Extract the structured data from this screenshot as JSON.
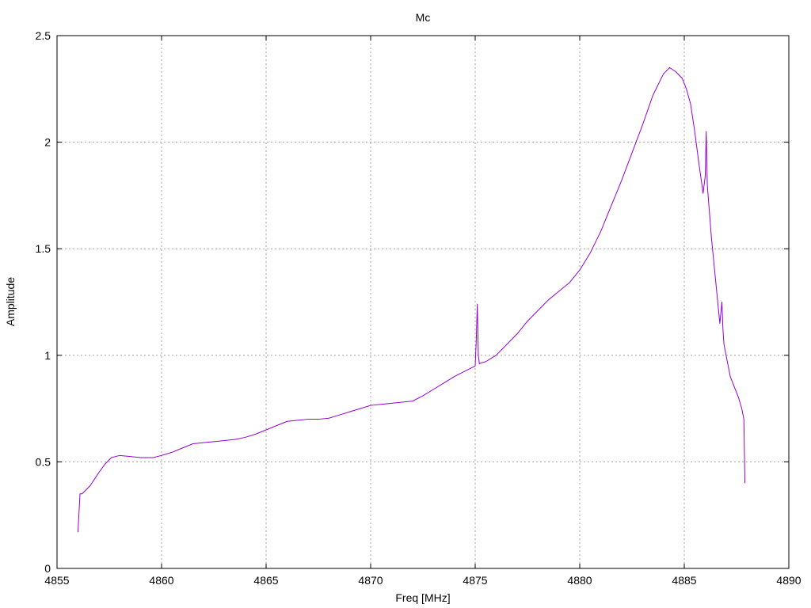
{
  "chart_data": {
    "type": "line",
    "title": "Mc",
    "xlabel": "Freq [MHz]",
    "ylabel": "Amplitude",
    "xlim": [
      4855,
      4890
    ],
    "ylim": [
      0,
      2.5
    ],
    "x_ticks": [
      4855,
      4860,
      4865,
      4870,
      4875,
      4880,
      4885,
      4890
    ],
    "y_ticks": [
      0,
      0.5,
      1,
      1.5,
      2,
      2.5
    ],
    "x_tick_labels": [
      "4855",
      "4860",
      "4865",
      "4870",
      "4875",
      "4880",
      "4885",
      "4890"
    ],
    "y_tick_labels": [
      "0",
      "0.5",
      "1",
      "1.5",
      "2",
      "2.5"
    ],
    "grid": true,
    "colors": {
      "series": "#9400d3",
      "grid": "#a0a0a0",
      "axis": "#000000"
    },
    "series": [
      {
        "color": "#9400d3",
        "x": [
          4856.0,
          4856.1,
          4856.2,
          4856.4,
          4856.6,
          4856.8,
          4857.0,
          4857.3,
          4857.6,
          4858.0,
          4858.5,
          4859.0,
          4859.6,
          4860.0,
          4860.5,
          4861.0,
          4861.5,
          4862.0,
          4862.5,
          4863.0,
          4863.5,
          4864.0,
          4864.5,
          4865.0,
          4865.5,
          4866.0,
          4866.5,
          4867.0,
          4867.5,
          4868.0,
          4868.5,
          4869.0,
          4869.5,
          4870.0,
          4870.5,
          4871.0,
          4871.5,
          4872.0,
          4872.5,
          4873.0,
          4873.5,
          4874.0,
          4874.5,
          4875.0,
          4875.05,
          4875.1,
          4875.15,
          4875.2,
          4875.3,
          4875.5,
          4876.0,
          4876.5,
          4877.0,
          4877.5,
          4878.0,
          4878.5,
          4879.0,
          4879.5,
          4880.0,
          4880.5,
          4881.0,
          4881.5,
          4882.0,
          4882.5,
          4883.0,
          4883.5,
          4884.0,
          4884.3,
          4884.6,
          4884.9,
          4885.1,
          4885.3,
          4885.5,
          4885.7,
          4885.9,
          4886.0,
          4886.05,
          4886.1,
          4886.3,
          4886.5,
          4886.7,
          4886.8,
          4886.85,
          4886.9,
          4887.0,
          4887.2,
          4887.4,
          4887.6,
          4887.75,
          4887.85,
          4887.9
        ],
        "y": [
          0.17,
          0.35,
          0.35,
          0.37,
          0.39,
          0.42,
          0.45,
          0.49,
          0.52,
          0.53,
          0.525,
          0.52,
          0.52,
          0.53,
          0.545,
          0.565,
          0.585,
          0.59,
          0.595,
          0.6,
          0.605,
          0.615,
          0.63,
          0.65,
          0.67,
          0.69,
          0.695,
          0.7,
          0.7,
          0.705,
          0.72,
          0.735,
          0.75,
          0.765,
          0.77,
          0.775,
          0.78,
          0.785,
          0.81,
          0.84,
          0.87,
          0.9,
          0.925,
          0.95,
          1.07,
          1.24,
          1.0,
          0.96,
          0.965,
          0.97,
          1.0,
          1.05,
          1.1,
          1.16,
          1.21,
          1.26,
          1.3,
          1.34,
          1.4,
          1.48,
          1.58,
          1.7,
          1.82,
          1.95,
          2.08,
          2.22,
          2.32,
          2.35,
          2.33,
          2.3,
          2.25,
          2.18,
          2.05,
          1.9,
          1.76,
          1.84,
          2.05,
          1.8,
          1.55,
          1.35,
          1.15,
          1.25,
          1.12,
          1.05,
          1.0,
          0.9,
          0.85,
          0.8,
          0.75,
          0.7,
          0.4
        ]
      }
    ]
  }
}
